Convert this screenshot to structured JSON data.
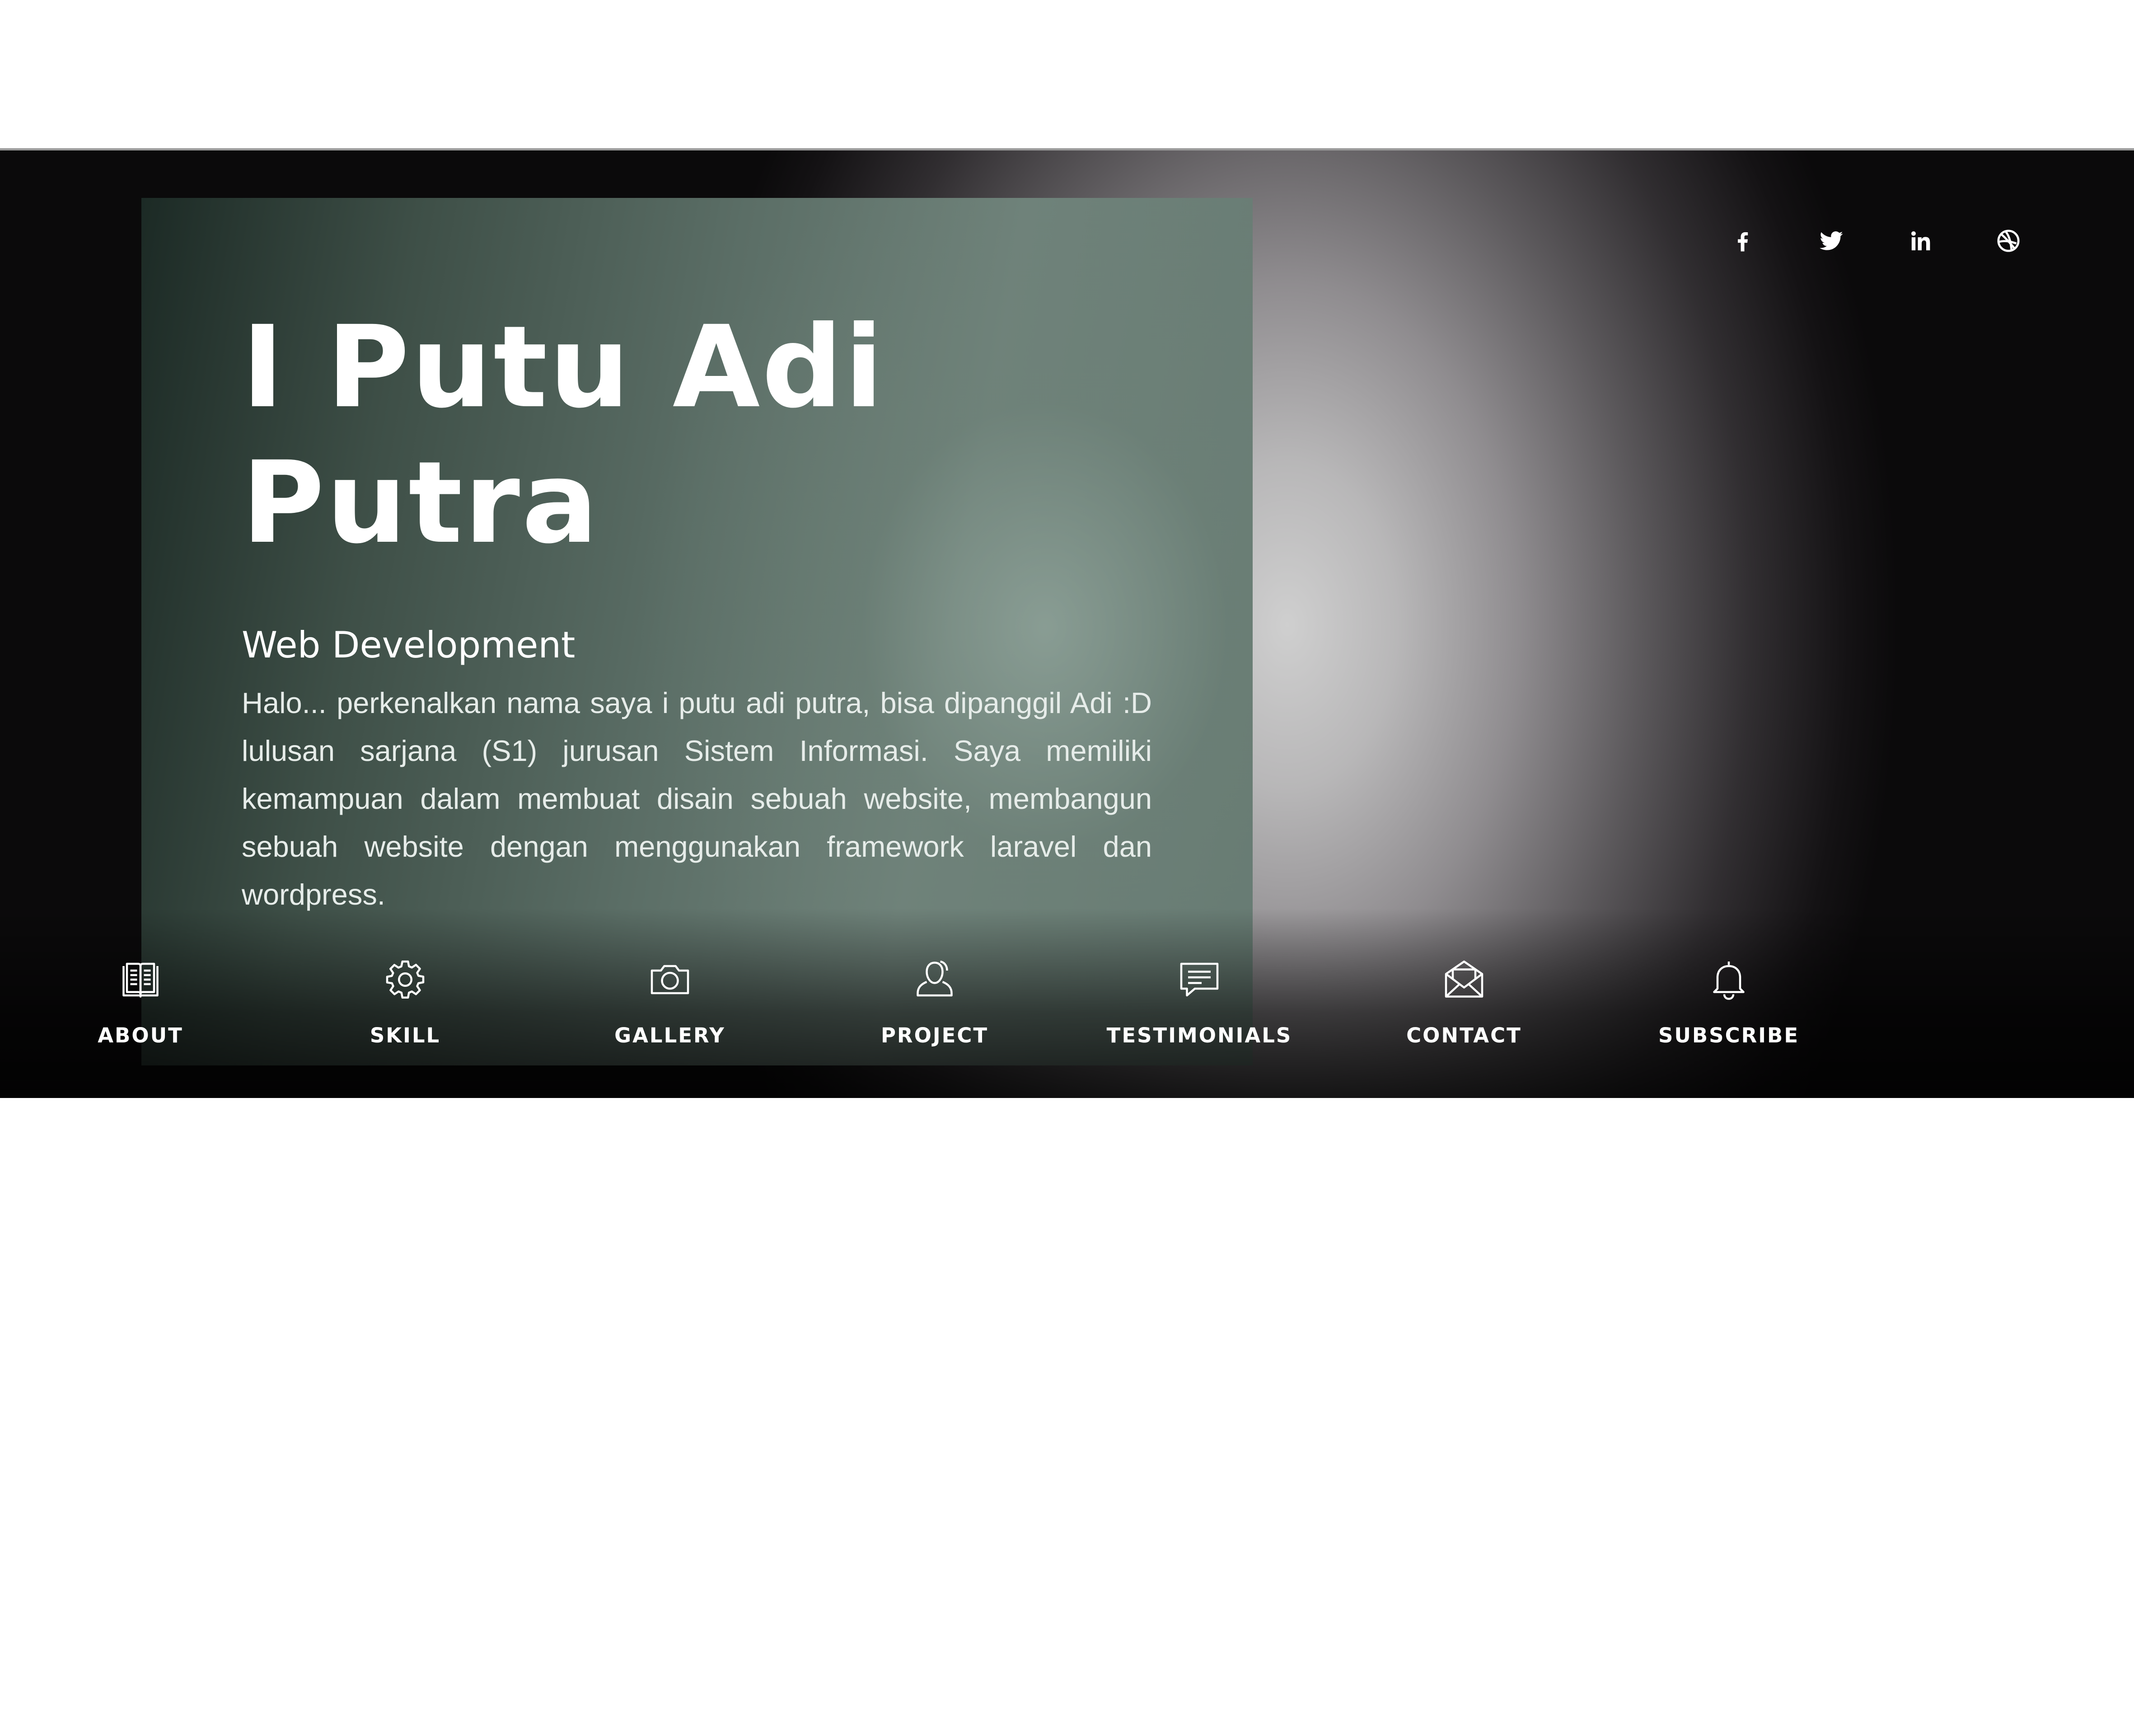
{
  "hero": {
    "name_line1": "I Putu Adi",
    "name_line2": "Putra",
    "role": "Web Development",
    "bio": "Halo... perkenalkan nama saya i putu adi putra, bisa dipanggil Adi :D lulusan sarjana (S1) jurusan Sistem Informasi. Saya memiliki kemampuan dalam membuat disain sebuah website, membangun sebuah website dengan menggunakan framework laravel dan wordpress."
  },
  "social": [
    {
      "icon": "facebook-icon"
    },
    {
      "icon": "twitter-icon"
    },
    {
      "icon": "linkedin-icon"
    },
    {
      "icon": "dribbble-icon"
    }
  ],
  "nav": {
    "items": [
      {
        "label": "ABOUT",
        "icon": "book-icon"
      },
      {
        "label": "SKILL",
        "icon": "gear-icon"
      },
      {
        "label": "GALLERY",
        "icon": "camera-icon"
      },
      {
        "label": "PROJECT",
        "icon": "user-icon"
      },
      {
        "label": "TESTIMONIALS",
        "icon": "chat-icon"
      },
      {
        "label": "CONTACT",
        "icon": "envelope-icon"
      },
      {
        "label": "SUBSCRIBE",
        "icon": "bell-icon"
      }
    ]
  },
  "colors": {
    "panel": "#5b6e66",
    "text": "#ffffff"
  }
}
